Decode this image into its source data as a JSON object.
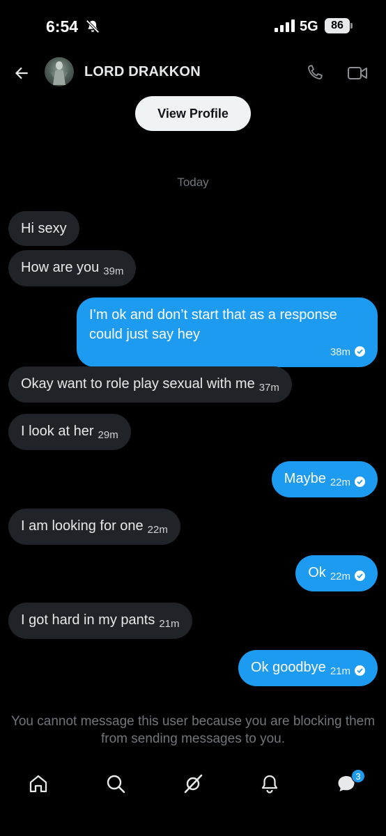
{
  "status_bar": {
    "time": "6:54",
    "network": "5G",
    "battery": "86"
  },
  "header": {
    "contact_name": "LORD DRAKKON"
  },
  "view_profile_label": "View Profile",
  "day_separator": "Today",
  "messages": [
    {
      "direction": "in",
      "text": "Hi sexy",
      "time": ""
    },
    {
      "direction": "in",
      "text": "How are you",
      "time": "39m"
    },
    {
      "direction": "out",
      "text": "I’m ok and don’t start that as a response could just say hey",
      "time": "38m",
      "seen": true
    },
    {
      "direction": "in",
      "text": "Okay want to role play sexual with me",
      "time": "37m"
    },
    {
      "direction": "in",
      "text": "I look at her",
      "time": "29m"
    },
    {
      "direction": "out",
      "text": "Maybe",
      "time": "22m",
      "seen": true
    },
    {
      "direction": "in",
      "text": "I am looking for one",
      "time": "22m"
    },
    {
      "direction": "out",
      "text": "Ok",
      "time": "22m",
      "seen": true
    },
    {
      "direction": "in",
      "text": "I got hard in my pants",
      "time": "21m"
    },
    {
      "direction": "out",
      "text": "Ok goodbye",
      "time": "21m",
      "seen": true
    }
  ],
  "blocked_notice": "You cannot message this user because you are blocking them from sending messages to you.",
  "bottom_nav": {
    "items": [
      "home-icon",
      "search-icon",
      "grok-icon",
      "notifications-icon",
      "messages-icon"
    ],
    "messages_badge": "3"
  },
  "colors": {
    "accent": "#1d9bf0",
    "incoming_bubble": "#202327",
    "background": "#000000"
  }
}
